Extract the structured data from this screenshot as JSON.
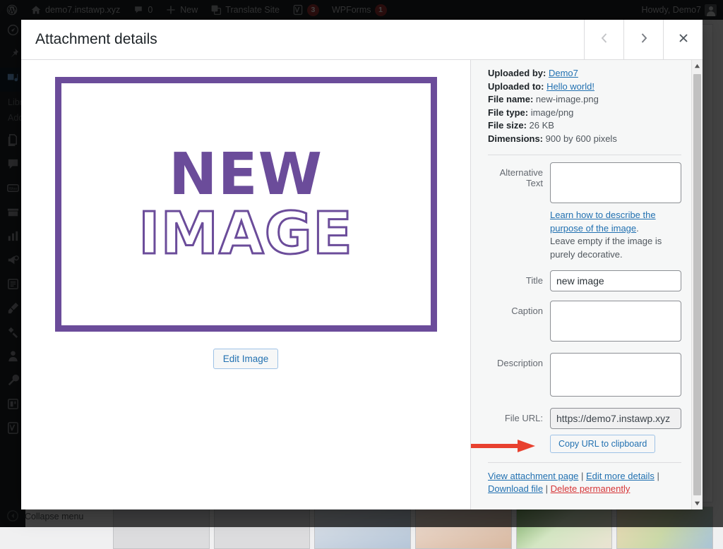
{
  "adminbar": {
    "site_name": "demo7.instawp.xyz",
    "comment_count": "0",
    "new_label": "New",
    "translate_label": "Translate Site",
    "yoast_badge": "3",
    "wpforms_label": "WPForms",
    "wpforms_badge": "1",
    "howdy": "Howdy, Demo7"
  },
  "sidebar": {
    "items": [
      {
        "name": "dashboard",
        "icon": "dashboard-icon"
      },
      {
        "name": "posts",
        "icon": "pin-icon"
      },
      {
        "name": "media",
        "icon": "media-icon",
        "current": true
      },
      {
        "name": "pages",
        "icon": "pages-icon"
      },
      {
        "name": "comments",
        "icon": "comment-icon"
      },
      {
        "name": "woocommerce",
        "icon": "woo-icon"
      },
      {
        "name": "products",
        "icon": "products-icon"
      },
      {
        "name": "analytics",
        "icon": "chart-icon"
      },
      {
        "name": "marketing",
        "icon": "megaphone-icon"
      },
      {
        "name": "forms",
        "icon": "form-icon"
      },
      {
        "name": "appearance",
        "icon": "brush-icon"
      },
      {
        "name": "plugins",
        "icon": "plug-icon"
      },
      {
        "name": "users",
        "icon": "user-icon"
      },
      {
        "name": "tools",
        "icon": "wrench-icon"
      },
      {
        "name": "settings",
        "icon": "settings-icon"
      },
      {
        "name": "seo",
        "icon": "yoast-icon"
      }
    ],
    "submenu": [
      "Library",
      "Add New"
    ],
    "collapse_label": "Collapse menu"
  },
  "modal": {
    "title": "Attachment details",
    "prev_label": "‹",
    "next_label": "›",
    "close_label": "×"
  },
  "preview": {
    "image_line1": "NEW",
    "image_line2": "IMAGE",
    "frame_color": "#6b4c9a",
    "edit_image_label": "Edit Image"
  },
  "details": {
    "meta": [
      {
        "label": "Uploaded by:",
        "value": "Demo7",
        "link": true
      },
      {
        "label": "Uploaded to:",
        "value": "Hello world!",
        "link": true
      },
      {
        "label": "File name:",
        "value": "new-image.png",
        "link": false
      },
      {
        "label": "File type:",
        "value": "image/png",
        "link": false
      },
      {
        "label": "File size:",
        "value": "26 KB",
        "link": false
      },
      {
        "label": "Dimensions:",
        "value": "900 by 600 pixels",
        "link": false
      }
    ],
    "alt_text": {
      "label": "Alternative Text",
      "value": "",
      "help_link": "Learn how to describe the purpose of the image",
      "help_rest": ". Leave empty if the image is purely decorative."
    },
    "title_field": {
      "label": "Title",
      "value": "new image"
    },
    "caption_field": {
      "label": "Caption",
      "value": ""
    },
    "description_field": {
      "label": "Description",
      "value": ""
    },
    "file_url": {
      "label": "File URL:",
      "value": "https://demo7.instawp.xyz"
    },
    "copy_button": "Copy URL to clipboard",
    "actions": {
      "view": "View attachment page",
      "edit": "Edit more details",
      "download": "Download file",
      "delete": "Delete permanently",
      "sep": " | "
    },
    "annotation_color": "#e8412f"
  }
}
